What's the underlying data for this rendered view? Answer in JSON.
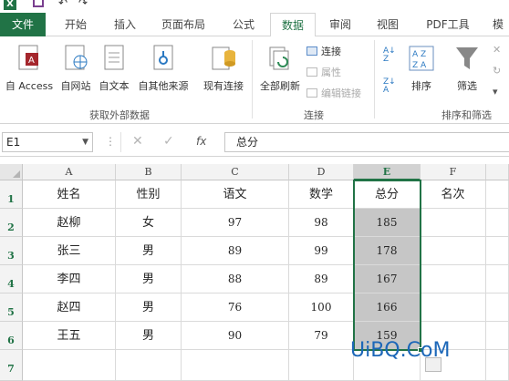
{
  "quick_access": {
    "app_letter": "X"
  },
  "tabs": [
    {
      "label": "文件"
    },
    {
      "label": "开始"
    },
    {
      "label": "插入"
    },
    {
      "label": "页面布局"
    },
    {
      "label": "公式"
    },
    {
      "label": "数据"
    },
    {
      "label": "审阅"
    },
    {
      "label": "视图"
    },
    {
      "label": "PDF工具"
    },
    {
      "label": "模"
    }
  ],
  "ribbon": {
    "get_external": {
      "buttons": [
        {
          "label": "自 Access"
        },
        {
          "label": "自网站"
        },
        {
          "label": "自文本"
        },
        {
          "label": "自其他来源"
        },
        {
          "label": "现有连接"
        }
      ],
      "group_label": "获取外部数据"
    },
    "connections": {
      "refresh_label": "全部刷新",
      "commands": [
        {
          "label": "连接"
        },
        {
          "label": "属性"
        },
        {
          "label": "编辑链接"
        }
      ],
      "group_label": "连接"
    },
    "sort_filter": {
      "az": "A Z",
      "sort_label": "排序",
      "filter_label": "筛选",
      "group_label": "排序和筛选"
    }
  },
  "formula_bar": {
    "name_box": "E1",
    "dots": "⋮",
    "cancel": "✕",
    "enter": "✓",
    "fx": "fx",
    "content": "总分"
  },
  "sheet": {
    "columns": [
      "A",
      "B",
      "C",
      "D",
      "E",
      "F"
    ],
    "selected_column": "E",
    "rows": [
      "1",
      "2",
      "3",
      "4",
      "5",
      "6",
      "7"
    ],
    "cells": [
      [
        "姓名",
        "性别",
        "语文",
        "数学",
        "总分",
        "名次"
      ],
      [
        "赵柳",
        "女",
        "97",
        "98",
        "185",
        ""
      ],
      [
        "张三",
        "男",
        "89",
        "99",
        "178",
        ""
      ],
      [
        "李四",
        "男",
        "88",
        "89",
        "167",
        ""
      ],
      [
        "赵四",
        "男",
        "76",
        "100",
        "166",
        ""
      ],
      [
        "王五",
        "男",
        "90",
        "79",
        "159",
        ""
      ]
    ]
  },
  "watermark": "UiBQ.CoM",
  "colors": {
    "excel_green": "#217346",
    "selection_fill": "#c6c6c6"
  }
}
